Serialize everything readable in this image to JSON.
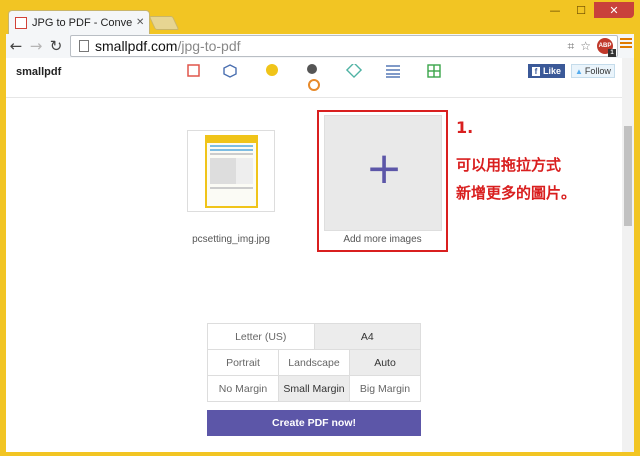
{
  "window": {
    "minimize": "—",
    "maximize": "☐",
    "close": "✕"
  },
  "tab": {
    "title": "JPG to PDF - Convert your",
    "close": "✕"
  },
  "toolbar": {
    "back": "←",
    "forward": "→",
    "reload": "↻",
    "url_host": "smallpdf.com",
    "url_path": "/jpg-to-pdf",
    "abp_label": "ABP",
    "abp_badge": "1"
  },
  "site": {
    "logo": "smallpdf",
    "facebook_like": "Like",
    "twitter_follow": "Follow",
    "tool_icons": [
      "compress-icon",
      "ppt-icon",
      "merge-icon",
      "split-icon",
      "jpg-icon",
      "word-icon",
      "excel-icon",
      "pdf-pie-icon"
    ]
  },
  "images": {
    "existing_filename": "pcsetting_img.jpg",
    "add_plus": "+",
    "add_label": "Add more images"
  },
  "annotation": {
    "number": "1.",
    "line1": "可以用拖拉方式",
    "line2": "新增更多的圖片。"
  },
  "options": {
    "page_size": [
      {
        "label": "Letter (US)",
        "selected": false
      },
      {
        "label": "A4",
        "selected": true
      }
    ],
    "orientation": [
      {
        "label": "Portrait",
        "selected": false
      },
      {
        "label": "Landscape",
        "selected": false
      },
      {
        "label": "Auto",
        "selected": true
      }
    ],
    "margin": [
      {
        "label": "No Margin",
        "selected": false
      },
      {
        "label": "Small Margin",
        "selected": true
      },
      {
        "label": "Big Margin",
        "selected": false
      }
    ]
  },
  "create_button": "Create PDF now!",
  "colors": {
    "accent": "#5c56a8",
    "annotation": "#d91f1f",
    "frame": "#f2c523"
  }
}
